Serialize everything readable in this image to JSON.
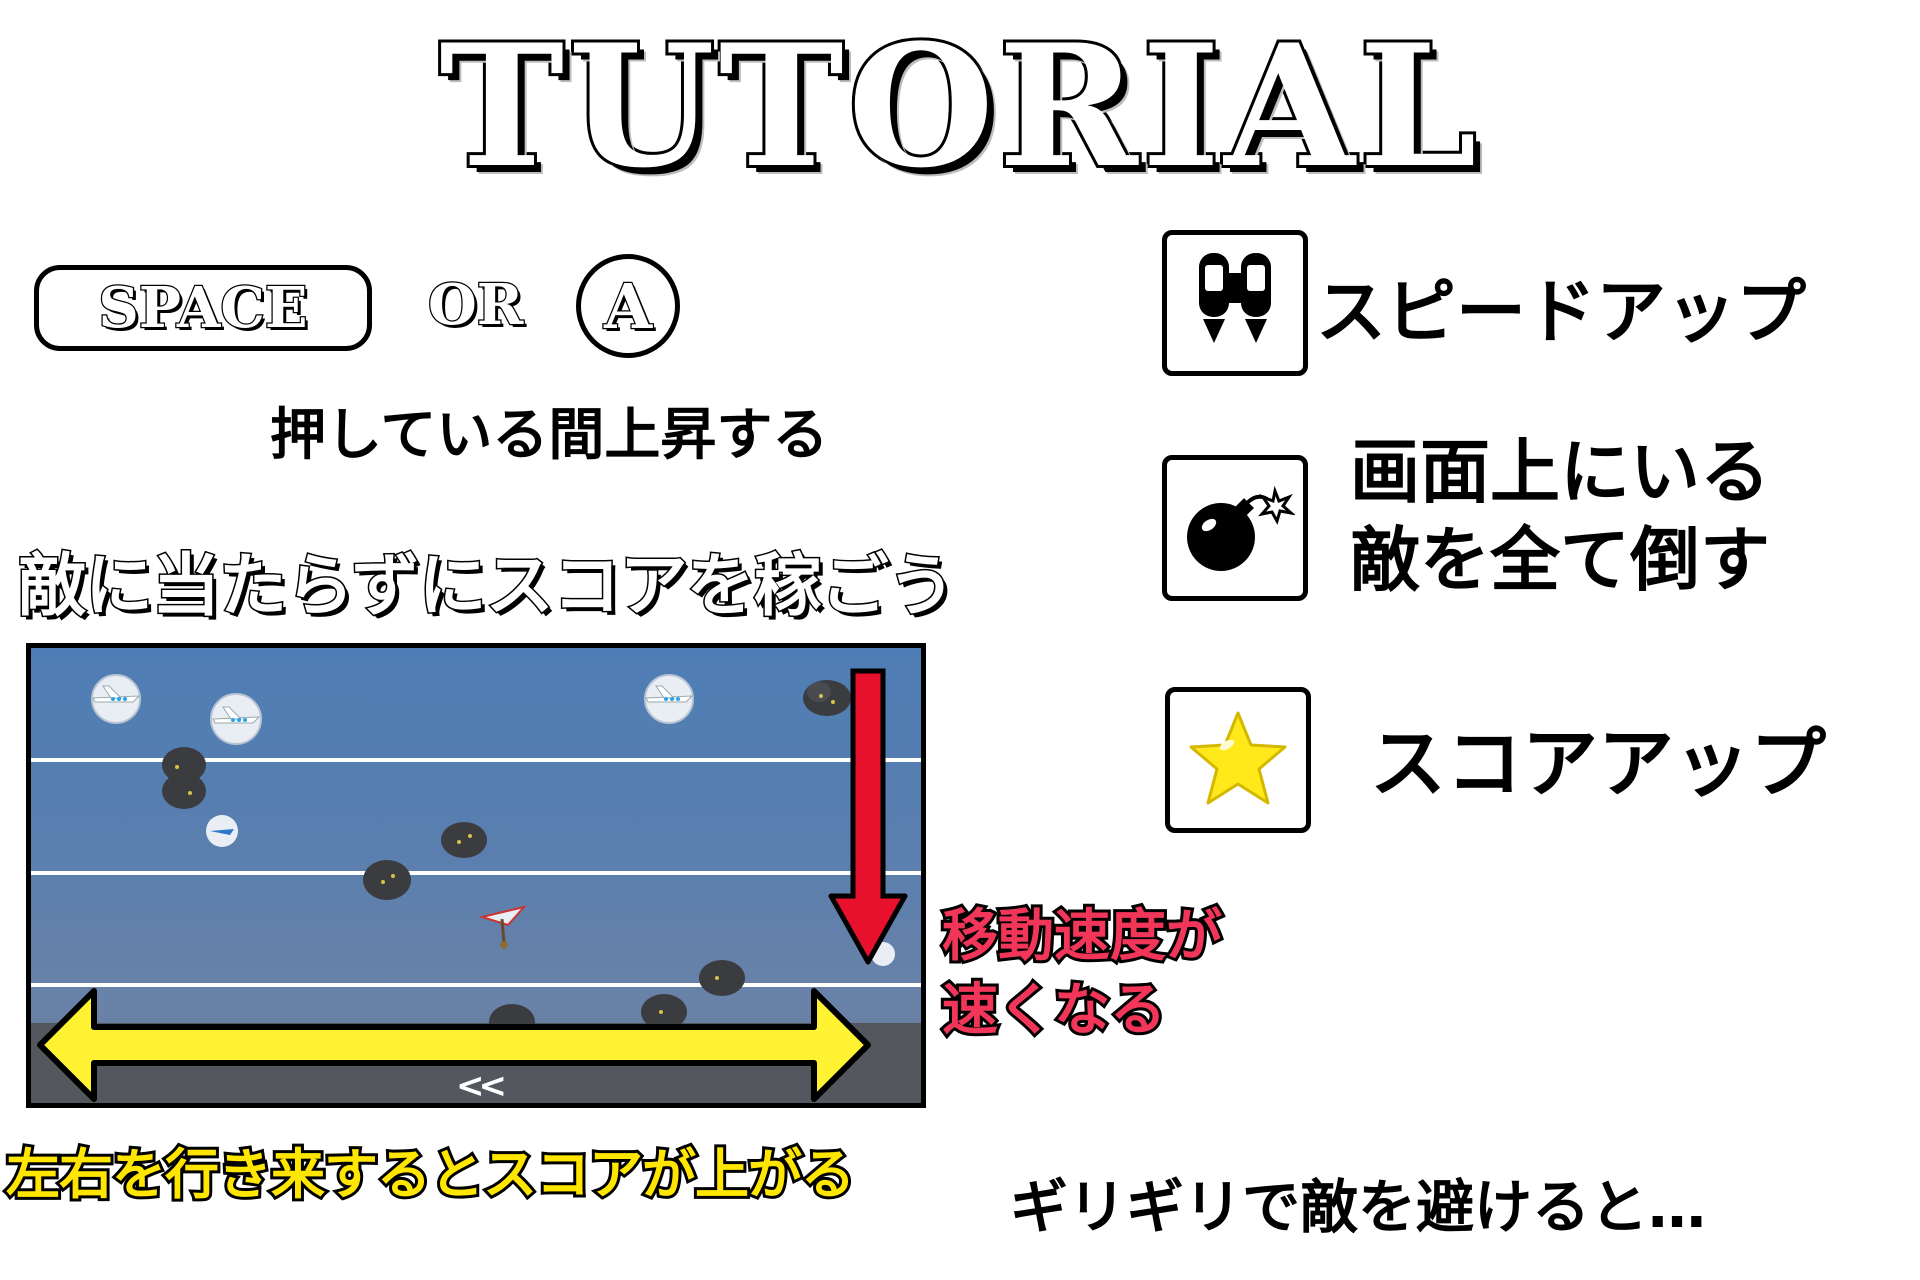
{
  "title": "TUTORIAL",
  "controls": {
    "space_key": "SPACE",
    "or": "OR",
    "a_key": "A",
    "hold_text": "押している間上昇する"
  },
  "goal_text": "敵に当たらずにスコアを稼ごう",
  "items": [
    {
      "icon": "jetpack-icon",
      "label": "スピードアップ"
    },
    {
      "icon": "bomb-icon",
      "label_line1": "画面上にいる",
      "label_line2": "敵を全て倒す"
    },
    {
      "icon": "star-icon",
      "label": "スコアアップ"
    }
  ],
  "annotations": {
    "speed_line1": "移動速度が",
    "speed_line2": "速くなる",
    "score_lr": "左右を行き来するとスコアが上がる",
    "near_miss": "ギリギリで敵を避けると…"
  },
  "colors": {
    "red_arrow": "#e8112d",
    "yellow_arrow": "#fff233",
    "speed_text": "#f2365a",
    "score_text": "#ffe600",
    "sky": "#4e7db5"
  }
}
